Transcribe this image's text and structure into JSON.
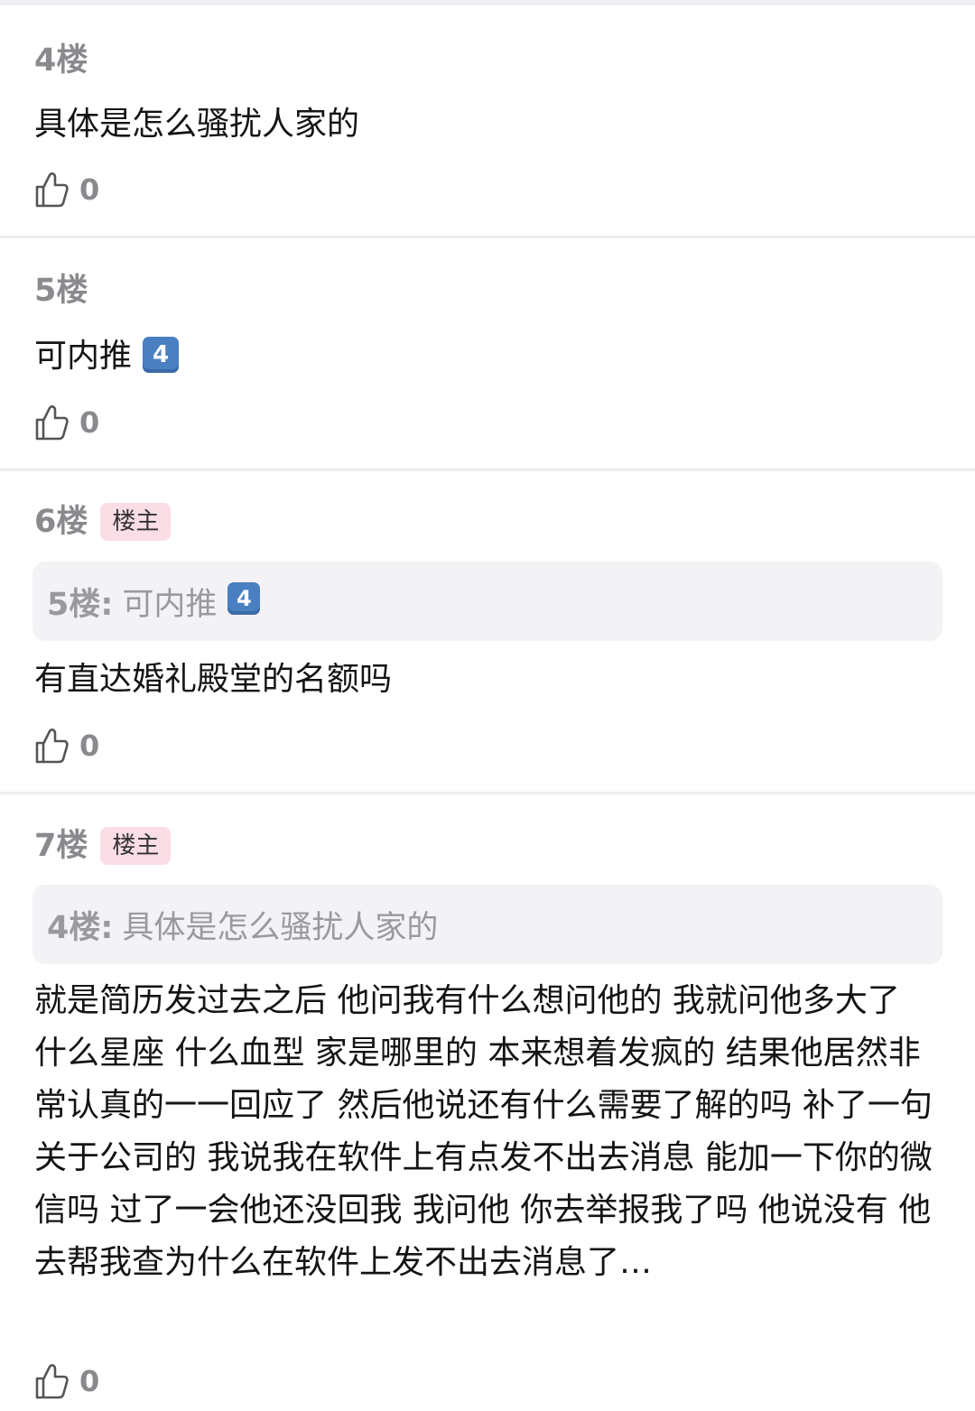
{
  "floors": [
    {
      "label": "4楼",
      "badge": "",
      "content": "具体是怎么骚扰人家的",
      "likes": "0"
    },
    {
      "label": "5楼",
      "badge": "",
      "content": "可内推",
      "content_emoji": "4",
      "likes": "0"
    },
    {
      "label": "6楼",
      "badge": "楼主",
      "quote_label": "5楼:",
      "quote_text": "可内推",
      "quote_emoji": "4",
      "content": "有直达婚礼殿堂的名额吗",
      "likes": "0"
    },
    {
      "label": "7楼",
      "badge": "楼主",
      "quote_label": "4楼:",
      "quote_text": "具体是怎么骚扰人家的",
      "content": "就是简历发过去之后 他问我有什么想问他的 我就问他多大了 什么星座 什么血型 家是哪里的 本来想着发疯的 结果他居然非常认真的一一回应了 然后他说还有什么需要了解的吗 补了一句关于公司的 我说我在软件上有点发不出去消息 能加一下你的微信吗 过了一会他还没回我 我问他 你去举报我了吗 他说没有 他去帮我查为什么在软件上发不出去消息了…",
      "likes": "0"
    }
  ],
  "icons": {
    "like": "thumbs-up-outline-icon"
  },
  "colors": {
    "badge_bg": "#fbdde6",
    "quote_bg": "#f3f3f6",
    "keycap": "#4a7fc1",
    "divider": "#ececf1"
  }
}
